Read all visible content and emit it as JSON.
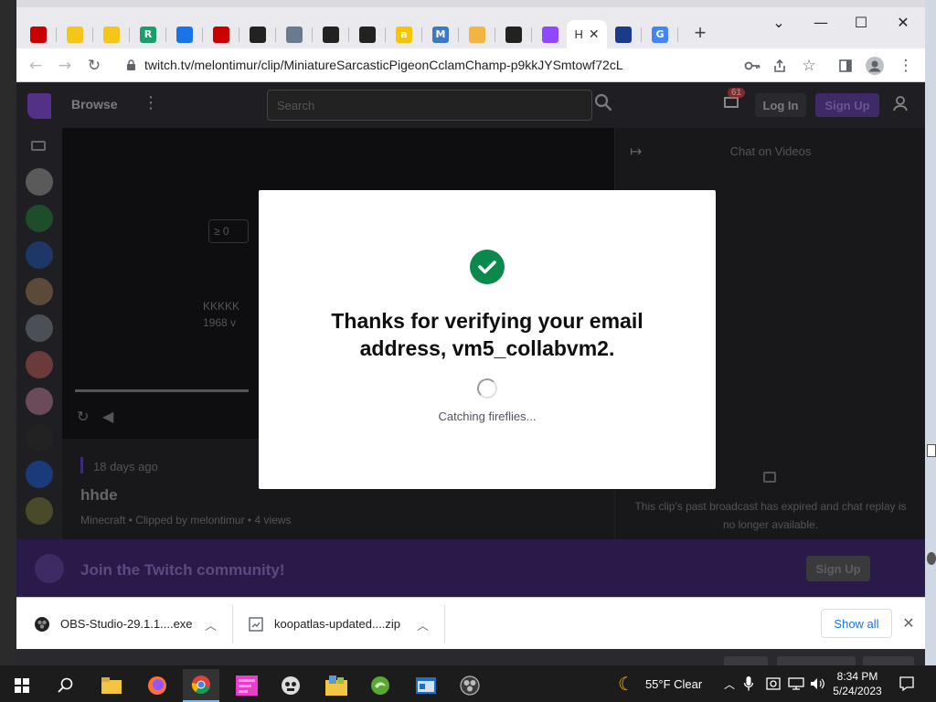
{
  "browser": {
    "tabs": [
      {
        "icon": "mega-icon",
        "label": "",
        "color": "#c80000"
      },
      {
        "icon": "banana-icon",
        "label": "",
        "color": "#f5c518"
      },
      {
        "icon": "banana-icon",
        "label": "",
        "color": "#f5c518"
      },
      {
        "icon": "r-icon",
        "label": "R",
        "color": "#1a9e6c"
      },
      {
        "icon": "download-icon",
        "label": "",
        "color": "#1a73e8"
      },
      {
        "icon": "mega-icon",
        "label": "",
        "color": "#c80000"
      },
      {
        "icon": "github-icon",
        "label": "",
        "color": "#222222"
      },
      {
        "icon": "dolphin-icon",
        "label": "",
        "color": "#6b7b8f"
      },
      {
        "icon": "github-icon",
        "label": "",
        "color": "#222222"
      },
      {
        "icon": "github-icon",
        "label": "",
        "color": "#222222"
      },
      {
        "icon": "a-icon",
        "label": "a",
        "color": "#f6c400"
      },
      {
        "icon": "m-icon",
        "label": "M",
        "color": "#3b79c4"
      },
      {
        "icon": "sunset-icon",
        "label": "",
        "color": "#f2b640"
      },
      {
        "icon": "github-icon",
        "label": "",
        "color": "#222222"
      },
      {
        "icon": "twitch-icon",
        "label": "",
        "color": "#9147ff"
      },
      {
        "icon": "twitch-active-tab",
        "label": "H",
        "active": true
      },
      {
        "icon": "chart-icon",
        "label": "",
        "color": "#1a3a8a"
      },
      {
        "icon": "google-icon",
        "label": "G",
        "color": "#4285f4"
      }
    ],
    "url": "twitch.tv/melontimur/clip/MiniatureSarcasticPigeonCclamChamp-p9kkJYSmtowf72cL"
  },
  "twitch": {
    "browse_label": "Browse",
    "search_placeholder": "Search",
    "notif_count": "61",
    "login_label": "Log In",
    "signup_label": "Sign Up",
    "player_overlay_top": "≥ 0",
    "player_overlay_line1": "KKKKK",
    "player_overlay_line2": "1968 v",
    "clip_age": "18 days ago",
    "clip_title": "hhde",
    "clip_meta": "Minecraft • Clipped by melontimur • 4 views",
    "chat_header": "Chat on Videos",
    "chat_message": "This clip's past broadcast has expired and chat replay is no longer available.",
    "join_banner_text": "Join the Twitch community!",
    "join_banner_button": "Sign Up"
  },
  "modal": {
    "title": "Thanks for verifying your email address, vm5_collabvm2.",
    "status": "Catching fireflies..."
  },
  "downloads": {
    "items": [
      {
        "name": "OBS-Studio-29.1.1....exe"
      },
      {
        "name": "koopatlas-updated....zip"
      }
    ],
    "show_all": "Show all"
  },
  "taskbar": {
    "weather": "55°F  Clear",
    "time": "8:34 PM",
    "date": "5/24/2023"
  }
}
